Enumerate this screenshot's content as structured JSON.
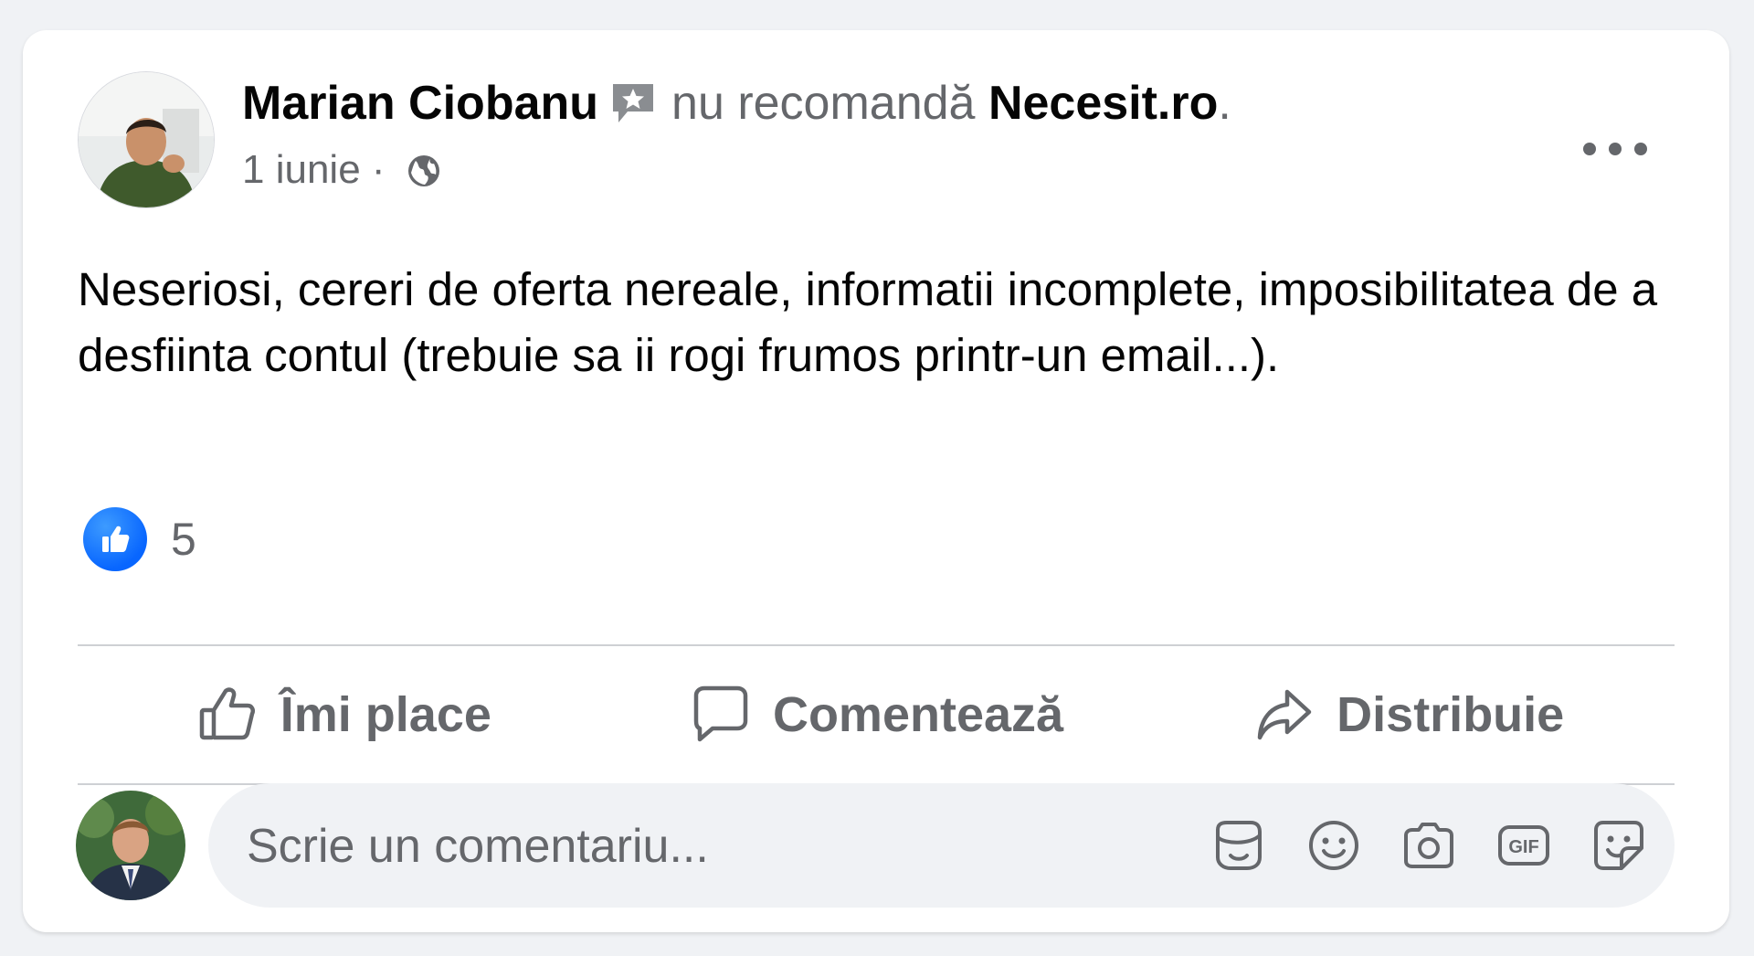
{
  "post": {
    "author": "Marian Ciobanu",
    "verb": "nu recomandă",
    "page": "Necesit.ro",
    "end_punct": ".",
    "date": "1 iunie",
    "separator": "·",
    "privacy_icon": "globe-icon",
    "text": "Neseriosi, cereri de oferta nereale, informatii incomplete, imposibilitatea de a desfiinta contul (trebuie sa ii rogi frumos printr-un email...).",
    "reaction_count": "5"
  },
  "actions": {
    "like": "Îmi place",
    "comment": "Comentează",
    "share": "Distribuie"
  },
  "comment_box": {
    "placeholder": "Scrie un comentariu...",
    "tools": [
      "avatar-sticker-icon",
      "emoji-icon",
      "camera-icon",
      "gif-icon",
      "sticker-icon"
    ]
  },
  "colors": {
    "accent": "#0866ff",
    "secondary_text": "#65676b",
    "background": "#f0f2f5"
  }
}
